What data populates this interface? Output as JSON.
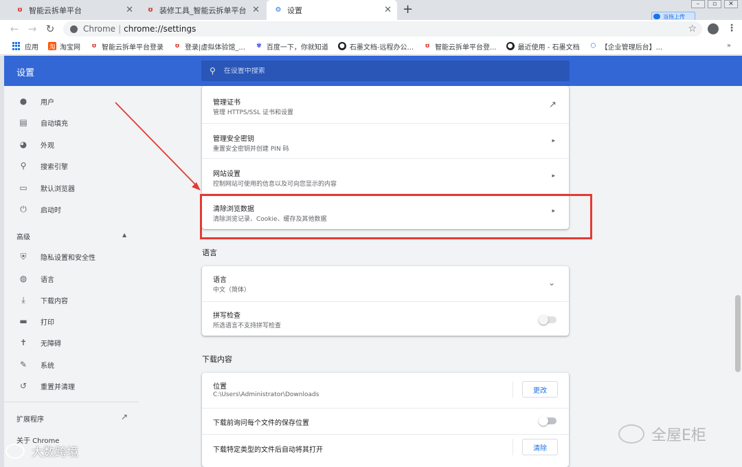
{
  "tabs": [
    {
      "title": "智能云拆单平台",
      "active": false
    },
    {
      "title": "装修工具_智能云拆单平台",
      "active": false
    },
    {
      "title": "设置",
      "active": true
    }
  ],
  "upload_badge": "当拖上传",
  "toolbar": {
    "scheme_label": "Chrome",
    "url": "chrome://settings"
  },
  "bookmarks": [
    {
      "label": "应用",
      "icon": "apps-icon"
    },
    {
      "label": "淘宝网",
      "icon": "taobao-icon"
    },
    {
      "label": "智能云拆单平台登录",
      "icon": "brand-icon"
    },
    {
      "label": "登录|虚拟体验馆_...",
      "icon": "brand-icon"
    },
    {
      "label": "百度一下，你就知道",
      "icon": "baidu-icon"
    },
    {
      "label": "石墨文档-远程办公...",
      "icon": "shimo-icon"
    },
    {
      "label": "智能云拆单平台登...",
      "icon": "brand-icon"
    },
    {
      "label": "最近使用 - 石墨文档",
      "icon": "shimo-icon"
    },
    {
      "label": "【企业管理后台】...",
      "icon": "shield-icon"
    }
  ],
  "header": {
    "title": "设置",
    "search_placeholder": "在设置中搜索"
  },
  "sidebar": {
    "items": [
      {
        "label": "用户",
        "icon": "person-icon"
      },
      {
        "label": "自动填充",
        "icon": "clipboard-icon"
      },
      {
        "label": "外观",
        "icon": "palette-icon"
      },
      {
        "label": "搜索引擎",
        "icon": "search-icon"
      },
      {
        "label": "默认浏览器",
        "icon": "browser-icon"
      },
      {
        "label": "启动时",
        "icon": "power-icon"
      }
    ],
    "advanced_label": "高级",
    "advanced_items": [
      {
        "label": "隐私设置和安全性",
        "icon": "shield-icon"
      },
      {
        "label": "语言",
        "icon": "globe-icon"
      },
      {
        "label": "下载内容",
        "icon": "download-icon"
      },
      {
        "label": "打印",
        "icon": "print-icon"
      },
      {
        "label": "无障碍",
        "icon": "accessibility-icon"
      },
      {
        "label": "系统",
        "icon": "wrench-icon"
      },
      {
        "label": "重置并清理",
        "icon": "history-icon"
      }
    ],
    "extensions_label": "扩展程序",
    "about_label": "关于 Chrome"
  },
  "privacy_card": {
    "rows": [
      {
        "title": "管理证书",
        "subtitle": "管理 HTTPS/SSL 证书和设置"
      },
      {
        "title": "管理安全密钥",
        "subtitle": "重置安全密钥并创建 PIN 码"
      },
      {
        "title": "网站设置",
        "subtitle": "控制网站可使用的信息以及可向您显示的内容"
      },
      {
        "title": "清除浏览数据",
        "subtitle": "清除浏览记录、Cookie、缓存及其他数据"
      }
    ]
  },
  "language_section": {
    "heading": "语言",
    "language_title": "语言",
    "language_value": "中文（简体）",
    "spellcheck_title": "拼写检查",
    "spellcheck_sub": "所选语言不支持拼写检查"
  },
  "downloads_section": {
    "heading": "下载内容",
    "location_title": "位置",
    "location_path": "C:\\Users\\Administrator\\Downloads",
    "change_button": "更改",
    "ask_title": "下载前询问每个文件的保存位置",
    "auto_open_title": "下载特定类型的文件后自动将其打开",
    "clear_button": "清除"
  },
  "watermarks": {
    "right": "全屋E柜",
    "left": "大数跨境"
  }
}
